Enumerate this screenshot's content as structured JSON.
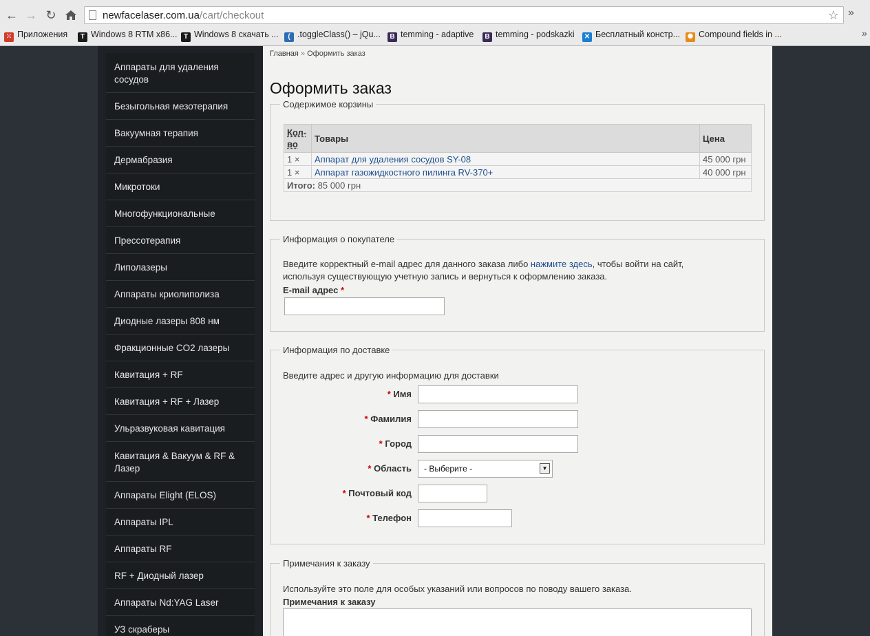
{
  "browser": {
    "url_domain": "newfacelaser.com.ua",
    "url_path": "/cart/checkout",
    "bookmarks": [
      {
        "label": "Приложения",
        "icon": "apps-grid-icon",
        "color": "#d23c2a"
      },
      {
        "label": "Windows 8 RTM x86...",
        "icon": "t-favicon-icon",
        "color": "#1a1a1a"
      },
      {
        "label": "Windows 8 скачать ...",
        "icon": "t-favicon-icon",
        "color": "#1a1a1a"
      },
      {
        "label": ".toggleClass() – jQu...",
        "icon": "jquery-icon",
        "color": "#2a6db3"
      },
      {
        "label": "temming - adaptive",
        "icon": "b-favicon-icon",
        "color": "#3a2a55"
      },
      {
        "label": "temming - podskazki",
        "icon": "b-favicon-icon",
        "color": "#3a2a55"
      },
      {
        "label": "Бесплатный констр...",
        "icon": "x-favicon-icon",
        "color": "#1a7fd4"
      },
      {
        "label": "Compound fields in ...",
        "icon": "drupal-sun-icon",
        "color": "#e88a1a"
      }
    ]
  },
  "sidebar": {
    "items": [
      "Аппараты для удаления сосудов",
      "Безыгольная мезотерапия",
      "Вакуумная терапия",
      "Дермабразия",
      "Микротоки",
      "Многофункциональные",
      "Прессотерапия",
      "Липолазеры",
      "Аппараты криолиполиза",
      "Диодные лазеры 808 нм",
      "Фракционные CO2 лазеры",
      "Кавитация + RF",
      "Кавитация + RF + Лазер",
      "Ульразвуковая кавитация",
      "Кавитация & Вакуум & RF & Лазер",
      "Аппараты Elight (ELOS)",
      "Аппараты IPL",
      "Аппараты RF",
      "RF + Диодный лазер",
      "Аппараты Nd:YAG Laser",
      "УЗ скраберы"
    ]
  },
  "breadcrumb": {
    "home": "Главная",
    "sep": "»",
    "current": "Оформить заказ"
  },
  "page_title": "Оформить заказ",
  "cart": {
    "legend": "Содержимое корзины",
    "headers": {
      "qty": "Кол-во",
      "product": "Товары",
      "price": "Цена"
    },
    "rows": [
      {
        "qty": "1 ×",
        "product": "Аппарат для удаления сосудов SY-08",
        "price": "45 000 грн"
      },
      {
        "qty": "1 ×",
        "product": "Аппарат газожидкостного пилинга RV-370+",
        "price": "40 000 грн"
      }
    ],
    "total_label": "Итого:",
    "total_value": "85 000 грн"
  },
  "customer": {
    "legend": "Информация о покупателе",
    "intro_before": "Введите корректный e-mail адрес для данного заказа либо ",
    "intro_link": "нажмите здесь",
    "intro_after": ", чтобы войти на сайт,",
    "intro_line2": "используя существующую учетную запись и вернуться к оформлению заказа.",
    "email_label": "E-mail адрес",
    "required_mark": "*"
  },
  "delivery": {
    "legend": "Информация по доставке",
    "intro": "Введите адрес и другую информацию для доставки",
    "required_mark": "*",
    "fields": {
      "first_name": "Имя",
      "last_name": "Фамилия",
      "city": "Город",
      "region": "Область",
      "postal_code": "Почтовый код",
      "phone": "Телефон"
    },
    "region_selected": "- Выберите -"
  },
  "notes": {
    "legend": "Примечания к заказу",
    "intro": "Используйте это поле для особых указаний или вопросов по поводу вашего заказа.",
    "label": "Примечания к заказу"
  }
}
